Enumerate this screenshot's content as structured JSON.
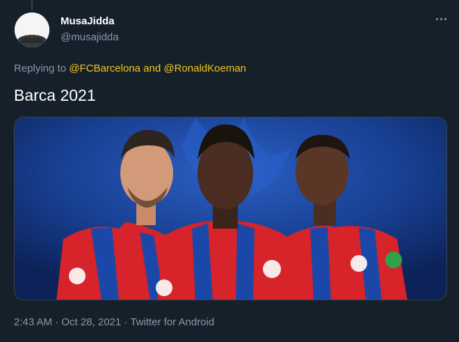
{
  "tweet": {
    "display_name": "MusaJidda",
    "username": "@musajidda",
    "reply_prefix": "Replying to",
    "reply_mention_1": "@FCBarcelona",
    "reply_and": "and",
    "reply_mention_2": "@RonaldKoeman",
    "text": "Barca 2021",
    "timestamp": "2:43 AM · Oct 28, 2021 · Twitter for Android",
    "more_icon": "more-icon",
    "avatar_icon": "avatar",
    "media_desc_icon": "tweet-photo"
  },
  "colors": {
    "background": "#15202b",
    "muted": "#8899a6",
    "mention": "#f5c518",
    "jersey_red": "#d7232a",
    "jersey_blue": "#1b48a8"
  }
}
